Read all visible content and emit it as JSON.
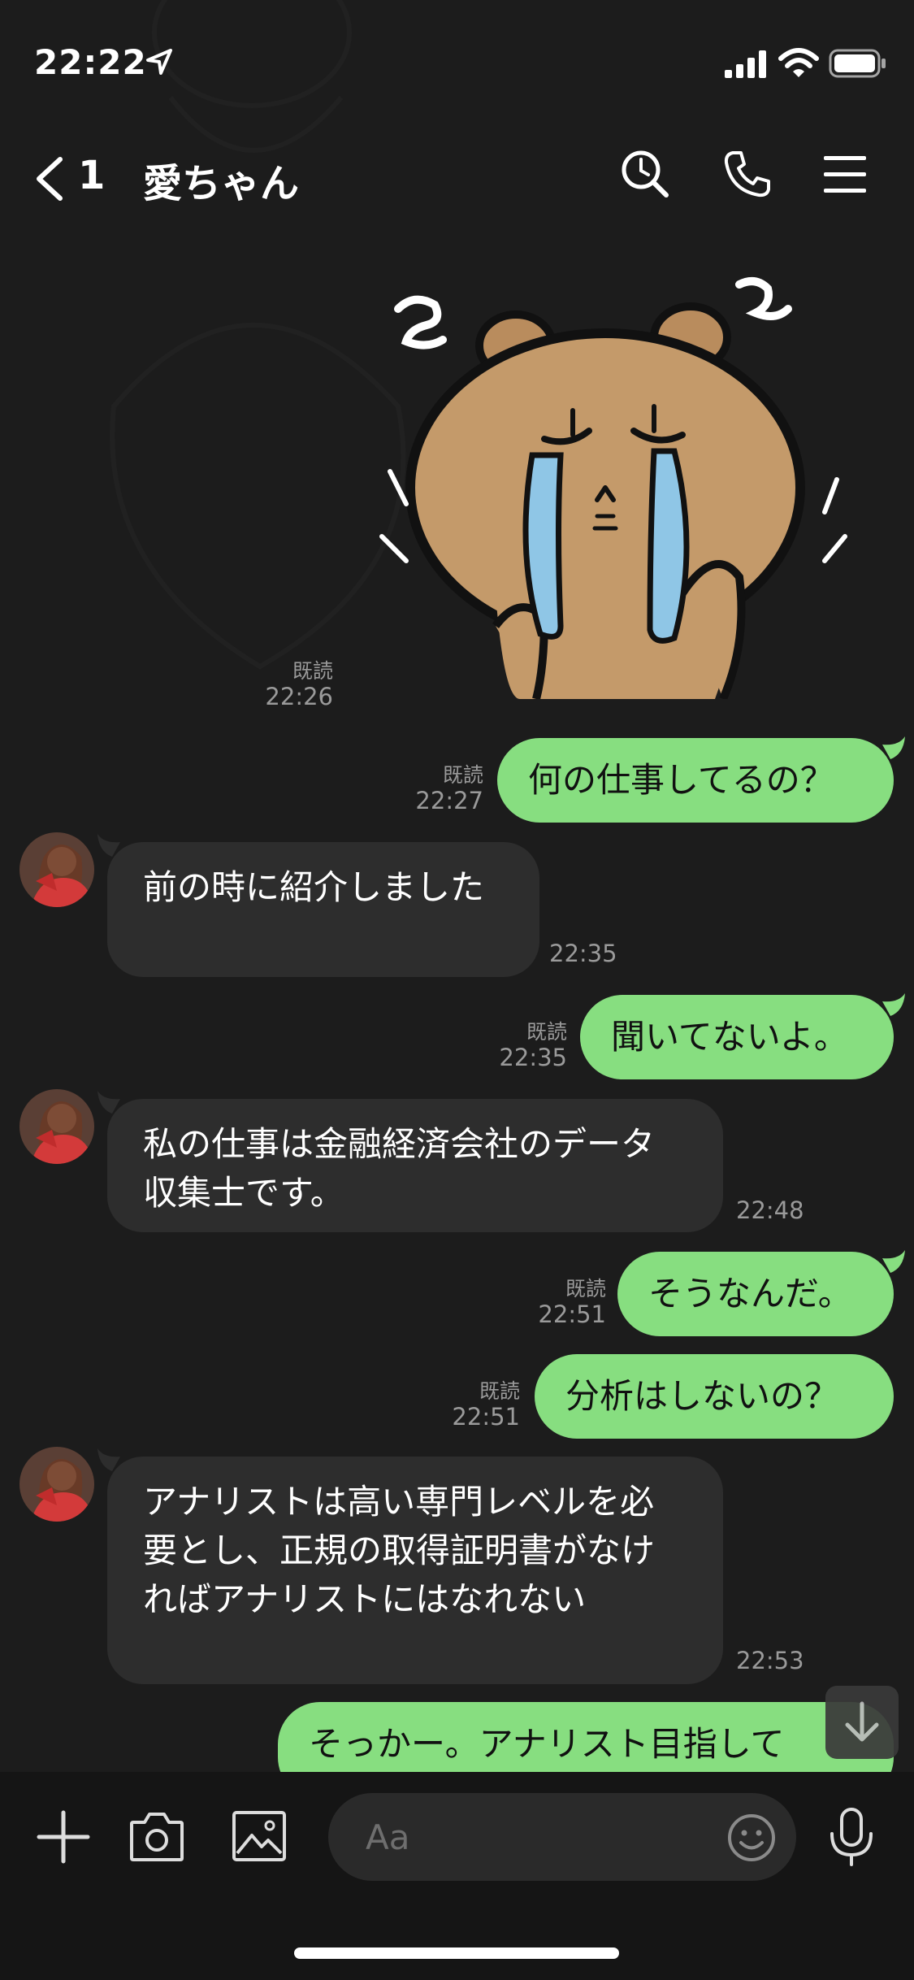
{
  "status_bar": {
    "time": "22:22"
  },
  "header": {
    "unread_count": "1",
    "title": "愛ちゃん"
  },
  "sticker": {
    "read": "既読",
    "time": "22:26"
  },
  "messages": [
    {
      "dir": "out",
      "read": "既読",
      "time": "22:27",
      "lines": [
        "何の仕事してるの？"
      ]
    },
    {
      "dir": "in",
      "time": "22:35",
      "lines": [
        "前の時に紹介しました"
      ]
    },
    {
      "dir": "out",
      "read": "既読",
      "time": "22:35",
      "lines": [
        "聞いてないよ。"
      ]
    },
    {
      "dir": "in",
      "time": "22:48",
      "lines": [
        "私の仕事は金融経済会社のデータ",
        "収集士です。"
      ]
    },
    {
      "dir": "out",
      "read": "既読",
      "time": "22:51",
      "lines": [
        "そうなんだ。"
      ]
    },
    {
      "dir": "out",
      "read": "既読",
      "time": "22:51",
      "lines": [
        "分析はしないの？"
      ]
    },
    {
      "dir": "in",
      "time": "22:53",
      "lines": [
        "アナリストは高い専門レベルを必",
        "要とし、正規の取得証明書がなけ",
        "ればアナリストにはなれない"
      ]
    },
    {
      "dir": "out",
      "lines": [
        "そっかー。アナリスト目指して"
      ]
    }
  ],
  "input": {
    "placeholder": "Aa"
  },
  "colors": {
    "background": "#1c1c1c",
    "outgoing_bubble": "#87de80",
    "incoming_bubble": "#2d2d2d",
    "meta_text": "#9a9a9a"
  }
}
